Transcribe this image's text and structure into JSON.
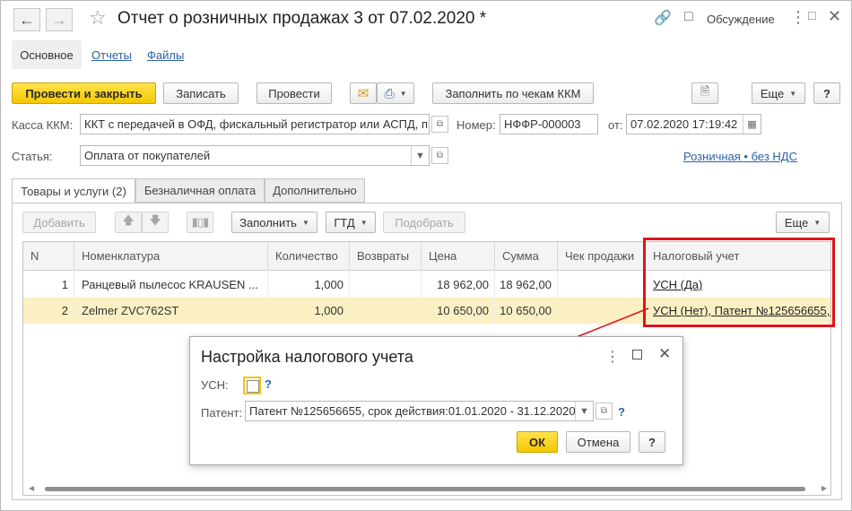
{
  "window": {
    "title": "Отчет о розничных продажах 3 от 07.02.2020 *",
    "discussion": "Обсуждение"
  },
  "nav_tabs": [
    "Основное",
    "Отчеты",
    "Файлы"
  ],
  "toolbar": {
    "post_close": "Провести и закрыть",
    "save": "Записать",
    "post": "Провести",
    "fill_kkm": "Заполнить по чекам ККМ",
    "more": "Еще",
    "help": "?"
  },
  "form": {
    "kassa_label": "Касса ККМ:",
    "kassa_value": "ККТ с передачей в ОФД, фискальный регистратор или АСПД, п",
    "number_label": "Номер:",
    "number_value": "НФФР-000003",
    "date_label": "от:",
    "date_value": "07.02.2020 17:19:42",
    "article_label": "Статья:",
    "article_value": "Оплата от покупателей",
    "vat_link": "Розничная • без НДС"
  },
  "page_tabs": [
    "Товары и услуги (2)",
    "Безналичная оплата",
    "Дополнительно"
  ],
  "table_toolbar": {
    "add": "Добавить",
    "fill": "Заполнить",
    "gtd": "ГТД",
    "pick": "Подобрать",
    "more": "Еще"
  },
  "table": {
    "columns": [
      "N",
      "Номенклатура",
      "Количество",
      "Возвраты",
      "Цена",
      "Сумма",
      "Чек продажи",
      "Налоговый учет"
    ],
    "rows": [
      {
        "n": "1",
        "item": "Ранцевый пылесос KRAUSEN ...",
        "qty": "1,000",
        "returns": "",
        "price": "18 962,00",
        "sum": "18 962,00",
        "receipt": "",
        "tax": "УСН (Да)"
      },
      {
        "n": "2",
        "item": "Zelmer ZVC762ST",
        "qty": "1,000",
        "returns": "",
        "price": "10 650,00",
        "sum": "10 650,00",
        "receipt": "",
        "tax": "УСН (Нет), Патент №125656655, д"
      }
    ]
  },
  "dialog": {
    "title": "Настройка налогового учета",
    "usn_label": "УСН:",
    "usn_checked": false,
    "patent_label": "Патент:",
    "patent_value": "Патент №125656655, срок действия:01.01.2020 - 31.12.2020",
    "ok": "ОК",
    "cancel": "Отмена",
    "help": "?",
    "hint": "?"
  },
  "colors": {
    "accent_yellow": "#f4c800",
    "link": "#2b62a8",
    "highlight_red": "#e0131a",
    "selected_row": "#fbf0c4"
  }
}
